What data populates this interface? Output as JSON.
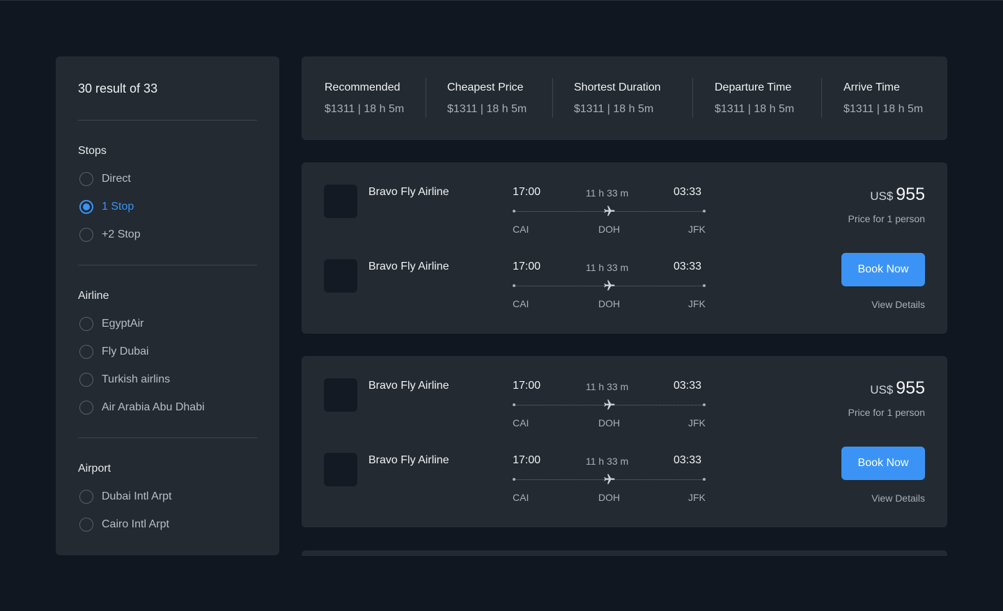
{
  "sidebar": {
    "results_title": "30 result of 33",
    "stops": {
      "title": "Stops",
      "options": [
        {
          "label": "Direct",
          "checked": false
        },
        {
          "label": "1 Stop",
          "checked": true
        },
        {
          "label": "+2 Stop",
          "checked": false
        }
      ]
    },
    "airline": {
      "title": "Airline",
      "options": [
        {
          "label": "EgyptAir",
          "checked": false
        },
        {
          "label": "Fly Dubai",
          "checked": false
        },
        {
          "label": "Turkish airlins",
          "checked": false
        },
        {
          "label": "Air Arabia Abu Dhabi",
          "checked": false
        }
      ]
    },
    "airport": {
      "title": "Airport",
      "options": [
        {
          "label": "Dubai Intl Arpt",
          "checked": false
        },
        {
          "label": "Cairo Intl Arpt",
          "checked": false
        }
      ]
    }
  },
  "sort_tabs": [
    {
      "label": "Recommended",
      "meta": "$1311 | 18 h 5m"
    },
    {
      "label": "Cheapest Price",
      "meta": "$1311 | 18 h 5m"
    },
    {
      "label": "Shortest Duration",
      "meta": "$1311 | 18 h 5m"
    },
    {
      "label": "Departure Time",
      "meta": "$1311 | 18 h 5m"
    },
    {
      "label": "Arrive Time",
      "meta": "$1311 | 18 h 5m"
    }
  ],
  "results": [
    {
      "legs": [
        {
          "airline": "Bravo Fly Airline",
          "depart_time": "17:00",
          "duration": "11 h 33 m",
          "arrive_time": "03:33",
          "from": "CAI",
          "via": "DOH",
          "to": "JFK"
        },
        {
          "airline": "Bravo Fly Airline",
          "depart_time": "17:00",
          "duration": "11 h 33 m",
          "arrive_time": "03:33",
          "from": "CAI",
          "via": "DOH",
          "to": "JFK"
        }
      ],
      "currency": "US$",
      "price": "955",
      "price_note": "Price for 1 person",
      "book_label": "Book Now",
      "details_label": "View Details"
    },
    {
      "legs": [
        {
          "airline": "Bravo Fly Airline",
          "depart_time": "17:00",
          "duration": "11 h 33 m",
          "arrive_time": "03:33",
          "from": "CAI",
          "via": "DOH",
          "to": "JFK"
        },
        {
          "airline": "Bravo Fly Airline",
          "depart_time": "17:00",
          "duration": "11 h 33 m",
          "arrive_time": "03:33",
          "from": "CAI",
          "via": "DOH",
          "to": "JFK"
        }
      ],
      "currency": "US$",
      "price": "955",
      "price_note": "Price for 1 person",
      "book_label": "Book Now",
      "details_label": "View Details"
    }
  ],
  "colors": {
    "background": "#111721",
    "panel": "#232a31",
    "accent": "#3b94f5",
    "muted_text": "#aab0b7"
  }
}
